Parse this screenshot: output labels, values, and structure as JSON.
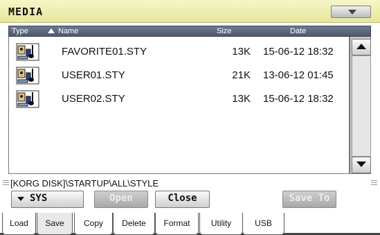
{
  "window": {
    "title": "MEDIA",
    "menu_icon": "chevron-down-icon"
  },
  "list_header": {
    "type": "Type",
    "name": "Name",
    "size": "Size",
    "date": "Date",
    "sort_icon": "sort-up-icon"
  },
  "files": [
    {
      "icon": "style-file-icon",
      "name": "FAVORITE01.STY",
      "size": "13K",
      "date": "15-06-12 18:32"
    },
    {
      "icon": "style-file-icon",
      "name": "USER01.STY",
      "size": "21K",
      "date": "13-06-12 01:45"
    },
    {
      "icon": "style-file-icon",
      "name": "USER02.STY",
      "size": "13K",
      "date": "15-06-12 18:32"
    }
  ],
  "path": "[KORG DISK]\\STARTUP\\ALL\\STYLE",
  "buttons": {
    "device": "SYS",
    "open": "Open",
    "close": "Close",
    "save_to": "Save To"
  },
  "tabs": [
    "Load",
    "Save",
    "Copy",
    "Delete",
    "Format",
    "Utility",
    "USB"
  ],
  "active_tab": "Save",
  "colors": {
    "title_bar": "#efefb6",
    "header": "#5e697e",
    "disabled_text": "#ececec"
  }
}
